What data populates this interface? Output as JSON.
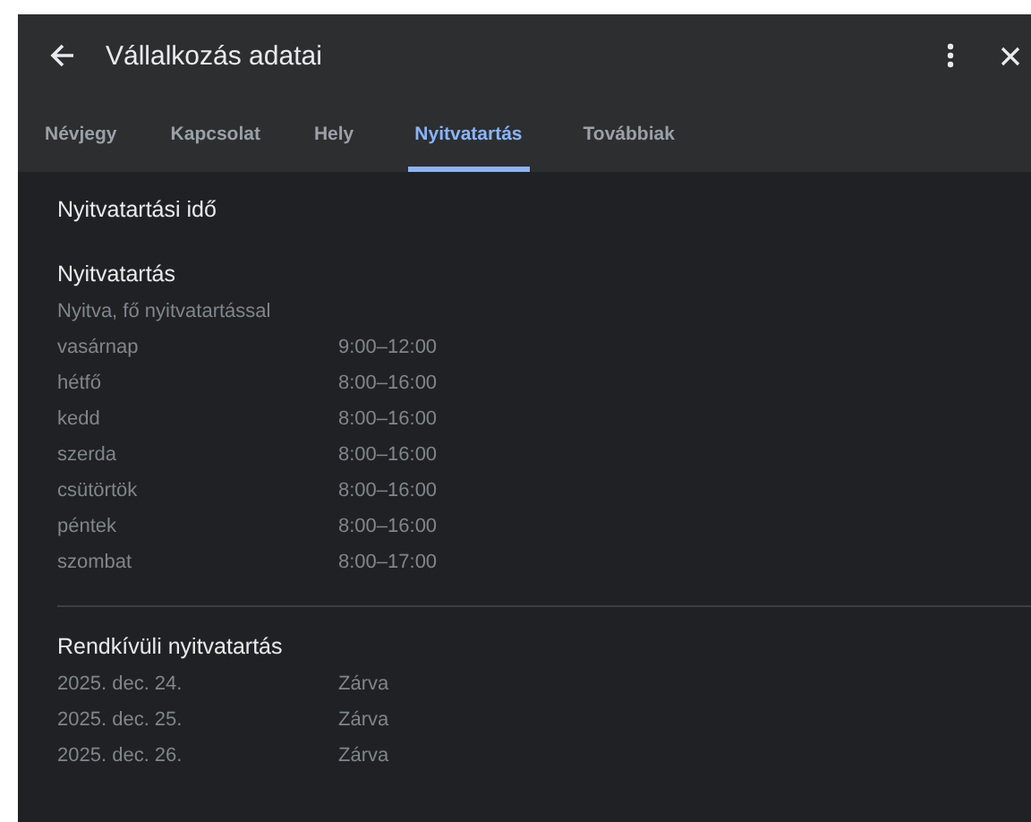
{
  "header": {
    "title": "Vállalkozás adatai"
  },
  "tabs": [
    {
      "label": "Névjegy",
      "selected": false
    },
    {
      "label": "Kapcsolat",
      "selected": false
    },
    {
      "label": "Hely",
      "selected": false
    },
    {
      "label": "Nyitvatartás",
      "selected": true
    },
    {
      "label": "Továbbiak",
      "selected": false
    }
  ],
  "section_title": "Nyitvatartási idő",
  "regular_hours": {
    "title": "Nyitvatartás",
    "subtitle": "Nyitva, fő nyitvatartással",
    "rows": [
      {
        "day": "vasárnap",
        "hours": "9:00–12:00"
      },
      {
        "day": "hétfő",
        "hours": "8:00–16:00"
      },
      {
        "day": "kedd",
        "hours": "8:00–16:00"
      },
      {
        "day": "szerda",
        "hours": "8:00–16:00"
      },
      {
        "day": "csütörtök",
        "hours": "8:00–16:00"
      },
      {
        "day": "péntek",
        "hours": "8:00–16:00"
      },
      {
        "day": "szombat",
        "hours": "8:00–17:00"
      }
    ]
  },
  "special_hours": {
    "title": "Rendkívüli nyitvatartás",
    "rows": [
      {
        "day": "2025. dec. 24.",
        "hours": "Zárva"
      },
      {
        "day": "2025. dec. 25.",
        "hours": "Zárva"
      },
      {
        "day": "2025. dec. 26.",
        "hours": "Zárva"
      }
    ]
  }
}
